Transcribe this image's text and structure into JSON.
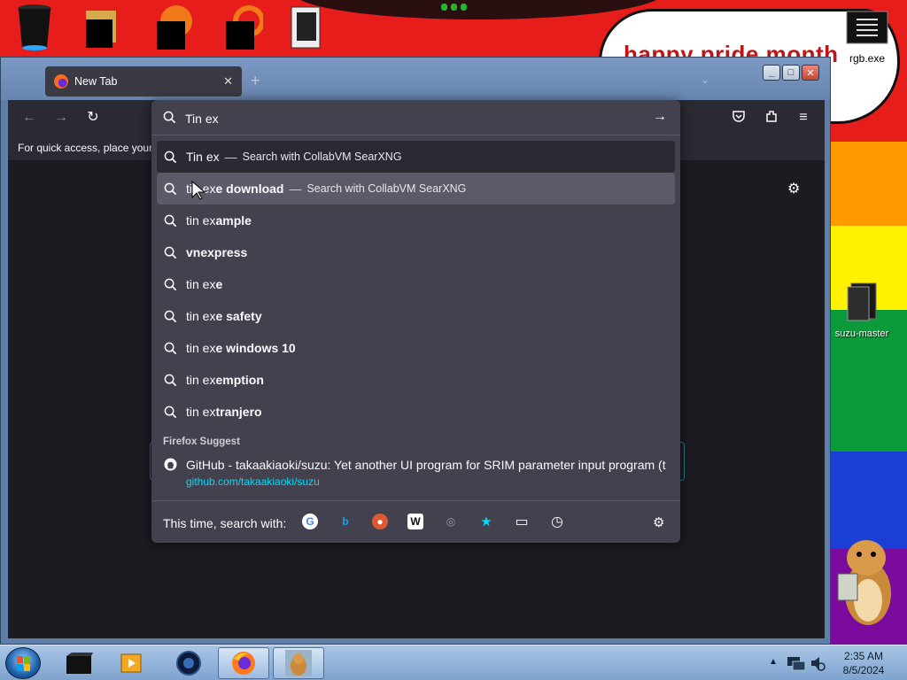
{
  "desktop": {
    "banner_text": "happy pride month",
    "icons": [
      {
        "label": "rgb.exe",
        "icon": "terminal-icon"
      },
      {
        "label": "suzu-master",
        "icon": "folder-icon"
      }
    ],
    "rainbow_colors": [
      "#ff9a00",
      "#fff200",
      "#0a9a3a",
      "#1b3fd4",
      "#7a0b9c"
    ]
  },
  "window": {
    "tab": {
      "title": "New Tab",
      "close": "✕"
    },
    "new_tab": "+",
    "tab_list": "⌄",
    "controls": {
      "minimize": "_",
      "maximize": "□",
      "close": "✕"
    }
  },
  "browser": {
    "bookmarks_hint": "For quick access, place your bookmarks here on the bookmarks toolbar.",
    "url_input_value": "Tin ex",
    "results": [
      {
        "prefix": "Tin ex",
        "bold": "",
        "action_sep": "—",
        "action": "Search with CollabVM SearXNG",
        "state": "selected"
      },
      {
        "prefix": "tin ex",
        "bold": "e download",
        "action_sep": "—",
        "action": "Search with CollabVM SearXNG",
        "state": "hovered"
      },
      {
        "prefix": "tin ex",
        "bold": "ample",
        "action_sep": "",
        "action": "",
        "state": ""
      },
      {
        "prefix": "",
        "bold": "vnexpress",
        "action_sep": "",
        "action": "",
        "state": ""
      },
      {
        "prefix": "tin ex",
        "bold": "e",
        "action_sep": "",
        "action": "",
        "state": ""
      },
      {
        "prefix": "tin ex",
        "bold": "e safety",
        "action_sep": "",
        "action": "",
        "state": ""
      },
      {
        "prefix": "tin ex",
        "bold": "e windows 10",
        "action_sep": "",
        "action": "",
        "state": ""
      },
      {
        "prefix": "tin ex",
        "bold": "emption",
        "action_sep": "",
        "action": "",
        "state": ""
      },
      {
        "prefix": "tin ex",
        "bold": "tranjero",
        "action_sep": "",
        "action": "",
        "state": ""
      }
    ],
    "suggest_section": "Firefox Suggest",
    "suggest": {
      "title": "GitHub - takaakiaoki/suzu: Yet another UI program for SRIM parameter input program (t",
      "url": "github.com/takaakiaoki/suzu"
    },
    "oneoff_label": "This time, search with:",
    "engines": [
      {
        "name": "google-icon",
        "glyph": "G",
        "color": "#4285f4"
      },
      {
        "name": "bing-icon",
        "glyph": "b",
        "color": "#1aa0e8"
      },
      {
        "name": "duckduckgo-icon",
        "glyph": "●",
        "color": "#de5833"
      },
      {
        "name": "wikipedia-icon",
        "glyph": "W",
        "color": "#111111"
      },
      {
        "name": "searxng-icon",
        "glyph": "◎",
        "color": "#9a9aa6"
      },
      {
        "name": "bookmarks-icon",
        "glyph": "★",
        "color": "#00ddff"
      },
      {
        "name": "tabs-icon",
        "glyph": "▭",
        "color": "#fbfbfe"
      },
      {
        "name": "history-icon",
        "glyph": "◷",
        "color": "#fbfbfe"
      }
    ]
  },
  "taskbar": {
    "time": "2:35 AM",
    "date": "8/5/2024"
  }
}
